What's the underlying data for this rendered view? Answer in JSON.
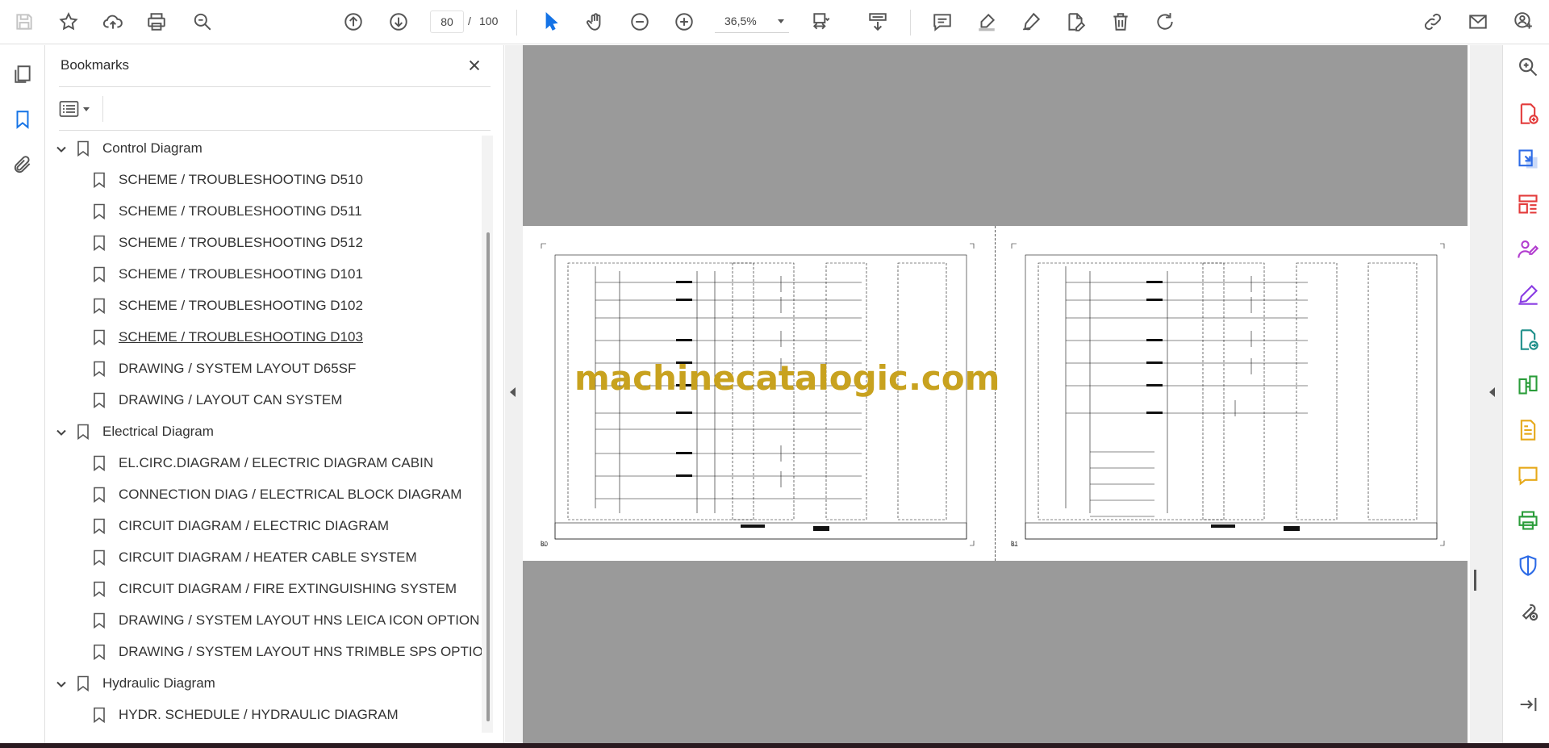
{
  "toolbar": {
    "current_page": "80",
    "page_separator": "/",
    "total_pages": "100",
    "zoom_level": "36,5%"
  },
  "bookmarks_panel": {
    "title": "Bookmarks",
    "items": [
      {
        "label": "Control Diagram",
        "level": 0
      },
      {
        "label": "SCHEME / TROUBLESHOOTING D510",
        "level": 1
      },
      {
        "label": "SCHEME / TROUBLESHOOTING D511",
        "level": 1
      },
      {
        "label": "SCHEME / TROUBLESHOOTING D512",
        "level": 1
      },
      {
        "label": "SCHEME / TROUBLESHOOTING D101",
        "level": 1
      },
      {
        "label": "SCHEME / TROUBLESHOOTING D102",
        "level": 1
      },
      {
        "label": "SCHEME / TROUBLESHOOTING D103",
        "level": 1
      },
      {
        "label": "DRAWING / SYSTEM LAYOUT D65SF",
        "level": 1
      },
      {
        "label": "DRAWING / LAYOUT CAN SYSTEM",
        "level": 1
      },
      {
        "label": "Electrical Diagram",
        "level": 0
      },
      {
        "label": "EL.CIRC.DIAGRAM / ELECTRIC DIAGRAM CABIN",
        "level": 1
      },
      {
        "label": "CONNECTION DIAG / ELECTRICAL BLOCK DIAGRAM",
        "level": 1
      },
      {
        "label": "CIRCUIT DIAGRAM / ELECTRIC DIAGRAM",
        "level": 1
      },
      {
        "label": "CIRCUIT DIAGRAM / HEATER CABLE SYSTEM",
        "level": 1
      },
      {
        "label": "CIRCUIT DIAGRAM / FIRE EXTINGUISHING SYSTEM",
        "level": 1
      },
      {
        "label": "DRAWING / SYSTEM LAYOUT HNS LEICA ICON OPTION",
        "level": 1
      },
      {
        "label": "DRAWING / SYSTEM LAYOUT HNS TRIMBLE SPS OPTION",
        "level": 1
      },
      {
        "label": "Hydraulic Diagram",
        "level": 0
      },
      {
        "label": "HYDR. SCHEDULE / HYDRAULIC DIAGRAM",
        "level": 1
      }
    ]
  },
  "document": {
    "left_page_number": "80",
    "right_page_number": "81",
    "watermark": "machinecatalogic.com"
  }
}
